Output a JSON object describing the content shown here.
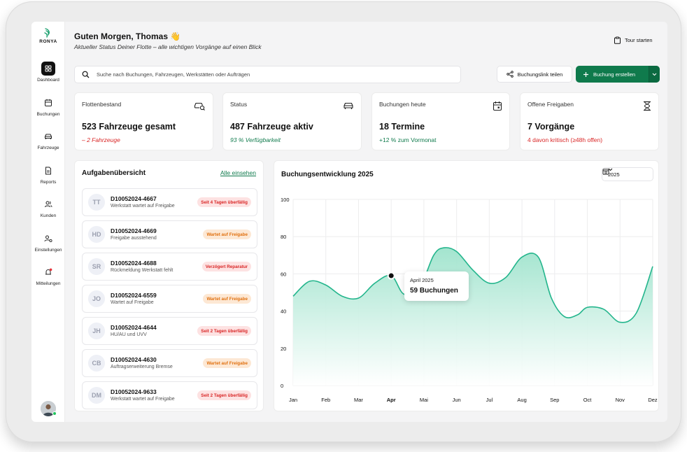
{
  "brand": {
    "name": "RONYA"
  },
  "sidebar": {
    "items": [
      {
        "label": "Dashboard",
        "icon": "dashboard-icon"
      },
      {
        "label": "Buchungen",
        "icon": "calendar-icon"
      },
      {
        "label": "Fahrzeuge",
        "icon": "car-icon"
      },
      {
        "label": "Reports",
        "icon": "document-icon"
      },
      {
        "label": "Kunden",
        "icon": "users-icon"
      },
      {
        "label": "Einstellungen",
        "icon": "user-settings-icon"
      },
      {
        "label": "Mitteilungen",
        "icon": "bell-icon"
      }
    ]
  },
  "header": {
    "greeting": "Guten Morgen, Thomas 👋",
    "subtitle": "Aktueller Status Deiner Flotte – alle wichtigen Vorgänge auf einen Blick",
    "tour_label": "Tour starten"
  },
  "search": {
    "placeholder": "Suche nach Buchungen, Fahrzeugen, Werkstätten oder Aufträgen"
  },
  "actions": {
    "share_label": "Buchungslink teilen",
    "create_label": "Buchung erstellen"
  },
  "cards": [
    {
      "title": "Flottenbestand",
      "value": "523 Fahrzeuge gesamt",
      "sub": "– 2 Fahrzeuge",
      "sub_color": "#d92626",
      "sub_italic": true
    },
    {
      "title": "Status",
      "value": "487 Fahrzeuge aktiv",
      "sub": "93 % Verfügbarkeit",
      "sub_color": "#0f7a4c",
      "sub_italic": true
    },
    {
      "title": "Buchungen heute",
      "value": "18 Termine",
      "sub": "+12 % zum Vormonat",
      "sub_color": "#0f7a4c",
      "sub_italic": false
    },
    {
      "title": "Offene Freigaben",
      "value": "7 Vorgänge",
      "sub": "4 davon kritisch (≥48h offen)",
      "sub_color": "#d92626",
      "sub_italic": false
    }
  ],
  "tasks": {
    "title": "Aufgabenübersicht",
    "link": "Alle einsehen",
    "items": [
      {
        "initials": "TT",
        "id": "D10052024-4667",
        "desc": "Werkstatt wartet auf Freigabe",
        "badge": "Seit 4 Tagen überfällig",
        "badge_type": "red"
      },
      {
        "initials": "HD",
        "id": "D10052024-4669",
        "desc": "Freigabe ausstehend",
        "badge": "Wartet auf Freigabe",
        "badge_type": "orange"
      },
      {
        "initials": "SR",
        "id": "D10052024-4688",
        "desc": "Rückmeldung Werkstatt fehlt",
        "badge": "Verzögert Reparatur",
        "badge_type": "red"
      },
      {
        "initials": "JO",
        "id": "D10052024-6559",
        "desc": "Wartet auf Freigabe",
        "badge": "Wartet auf Freigabe",
        "badge_type": "orange"
      },
      {
        "initials": "JH",
        "id": "D10052024-4644",
        "desc": "HU/AU und UVV",
        "badge": "Seit 2 Tagen überfällig",
        "badge_type": "red"
      },
      {
        "initials": "CB",
        "id": "D10052024-4630",
        "desc": "Auftragserweiterung Bremse",
        "badge": "Wartet auf Freigabe",
        "badge_type": "orange"
      },
      {
        "initials": "DM",
        "id": "D10052024-9633",
        "desc": "Werkstatt wartet auf Freigabe",
        "badge": "Seit 2 Tagen überfällig",
        "badge_type": "red"
      }
    ]
  },
  "chart_panel": {
    "year": "2025",
    "tooltip": {
      "label": "April 2025",
      "value": "59 Buchungen"
    }
  },
  "chart_data": {
    "type": "area",
    "title": "Buchungsentwicklung 2025",
    "categories": [
      "Jan",
      "Feb",
      "Mar",
      "Apr",
      "Mai",
      "Jun",
      "Jul",
      "Aug",
      "Sep",
      "Oct",
      "Nov",
      "Dez"
    ],
    "y_ticks": [
      0,
      20,
      40,
      60,
      80,
      100
    ],
    "ylim": [
      0,
      100
    ],
    "series": [
      {
        "points": [
          [
            0,
            48
          ],
          [
            0.5,
            56
          ],
          [
            1,
            54
          ],
          [
            1.5,
            48
          ],
          [
            2,
            47
          ],
          [
            2.5,
            55
          ],
          [
            3,
            59
          ],
          [
            3.4,
            49
          ],
          [
            3.9,
            54
          ],
          [
            4.3,
            70
          ],
          [
            4.6,
            74
          ],
          [
            5,
            72
          ],
          [
            5.5,
            62
          ],
          [
            6,
            55
          ],
          [
            6.5,
            58
          ],
          [
            7,
            69
          ],
          [
            7.5,
            69
          ],
          [
            7.9,
            47
          ],
          [
            8.3,
            37
          ],
          [
            8.7,
            38
          ],
          [
            9,
            42
          ],
          [
            9.5,
            41
          ],
          [
            10,
            34
          ],
          [
            10.5,
            39
          ],
          [
            11,
            64
          ]
        ]
      }
    ],
    "highlight": {
      "category": "Apr",
      "value": 59
    },
    "colors": {
      "line": "#23b58c",
      "fill_top": "#9ee3cc",
      "fill_bottom": "#ffffff"
    },
    "grid": true
  }
}
